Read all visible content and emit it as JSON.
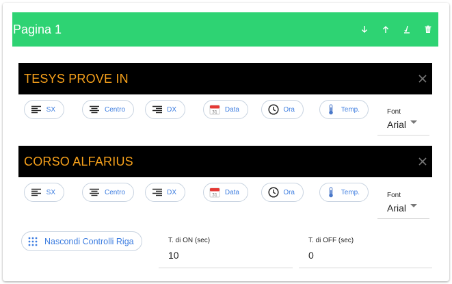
{
  "page": {
    "title": "Pagina 1",
    "header_bg": "#2ed373",
    "actions": [
      "arrow-down-icon",
      "arrow-up-icon",
      "sort-icon",
      "trash-icon"
    ]
  },
  "rows": [
    {
      "title": "TESYS PROVE IN",
      "title_color": "#f7a11b",
      "controls": {
        "sx": "SX",
        "centro": "Centro",
        "dx": "DX",
        "data": "Data",
        "ora": "Ora",
        "temp": "Temp."
      },
      "font": {
        "label": "Font",
        "value": "Arial"
      }
    },
    {
      "title": "CORSO ALFARIUS",
      "title_color": "#f7a11b",
      "controls": {
        "sx": "SX",
        "centro": "Centro",
        "dx": "DX",
        "data": "Data",
        "ora": "Ora",
        "temp": "Temp."
      },
      "font": {
        "label": "Font",
        "value": "Arial"
      }
    }
  ],
  "footer": {
    "hide_controls_label": "Nascondi Controlli Riga",
    "t_on": {
      "label": "T. di ON (sec)",
      "value": "10"
    },
    "t_off": {
      "label": "T. di OFF (sec)",
      "value": "0"
    }
  },
  "colors": {
    "accent": "#3d7de0",
    "row_bg": "#000000",
    "chip_border": "#c8d3e0"
  }
}
